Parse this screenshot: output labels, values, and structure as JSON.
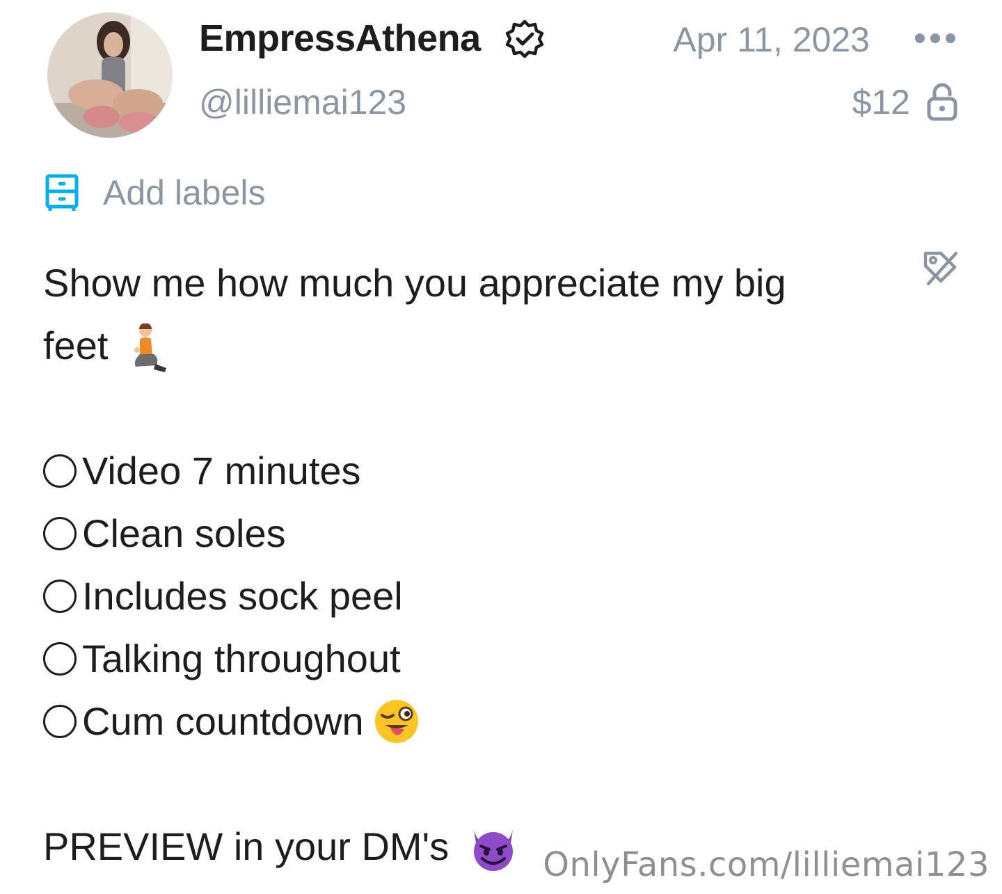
{
  "header": {
    "display_name": "EmpressAthena",
    "handle": "@lilliemai123",
    "date": "Apr 11, 2023",
    "price": "$12",
    "icons": [
      "verified-badge-icon",
      "more-dots-icon",
      "lock-icon"
    ]
  },
  "labels": {
    "add_label": "Add labels",
    "icon": "drawer-icon"
  },
  "post": {
    "intro_line1": "Show me how much you appreciate my big",
    "intro_line2": "feet",
    "intro_emoji": "kneeling-person",
    "items": [
      {
        "text": "Video 7 minutes"
      },
      {
        "text": "Clean soles"
      },
      {
        "text": "Includes sock peel"
      },
      {
        "text": "Talking throughout"
      },
      {
        "text": "Cum countdown",
        "emoji": "winking-tongue-face"
      }
    ],
    "footer_line": "PREVIEW in your DM's",
    "footer_emoji": "smiling-devil"
  },
  "watermark": "OnlyFans.com/lilliemai123",
  "colors": {
    "muted": "#8a96a3",
    "accent": "#00aff0",
    "text": "#1d1d1d"
  }
}
